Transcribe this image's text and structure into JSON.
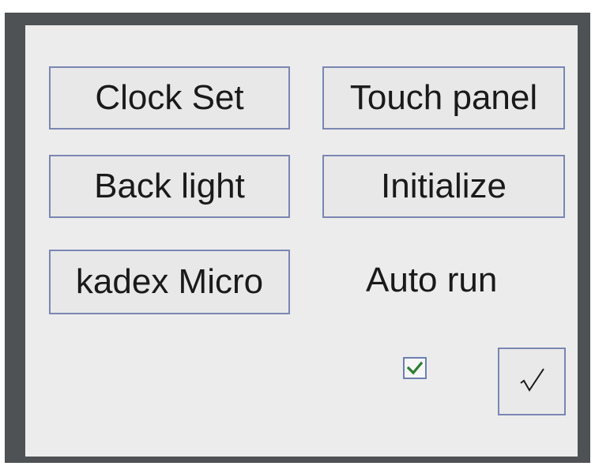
{
  "buttons": {
    "clock_set": "Clock Set",
    "touch_panel": "Touch panel",
    "back_light": "Back light",
    "initialize": "Initialize",
    "kadex_micro": "kadex Micro"
  },
  "auto_run": {
    "label": "Auto run",
    "checked": true
  },
  "confirm_button": {
    "icon": "checkmark-icon"
  },
  "colors": {
    "frame": "#4e5254",
    "panel": "#ececec",
    "button_border": "#7b86b3",
    "check_green": "#2e7d32"
  }
}
